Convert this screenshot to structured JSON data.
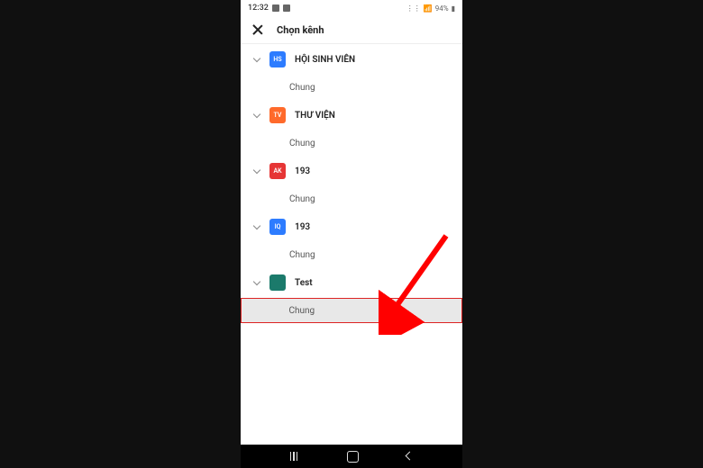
{
  "status": {
    "time": "12:32",
    "battery": "94%"
  },
  "header": {
    "title": "Chọn kênh"
  },
  "channels": [
    {
      "name": "HỘI SINH VIÊN",
      "avatar_text": "HS",
      "avatar_color": "#2d7cff",
      "sub": "Chung"
    },
    {
      "name": "THƯ VIỆN",
      "avatar_text": "TV",
      "avatar_color": "#ff6a2b",
      "sub": "Chung"
    },
    {
      "name": "193",
      "avatar_text": "AK",
      "avatar_color": "#e63535",
      "sub": "Chung"
    },
    {
      "name": "193",
      "avatar_text": "IQ",
      "avatar_color": "#2d7cff",
      "sub": "Chung"
    },
    {
      "name": "Test",
      "avatar_text": "",
      "avatar_color": "#1b7a6b",
      "sub": "Chung",
      "highlighted": true
    }
  ]
}
